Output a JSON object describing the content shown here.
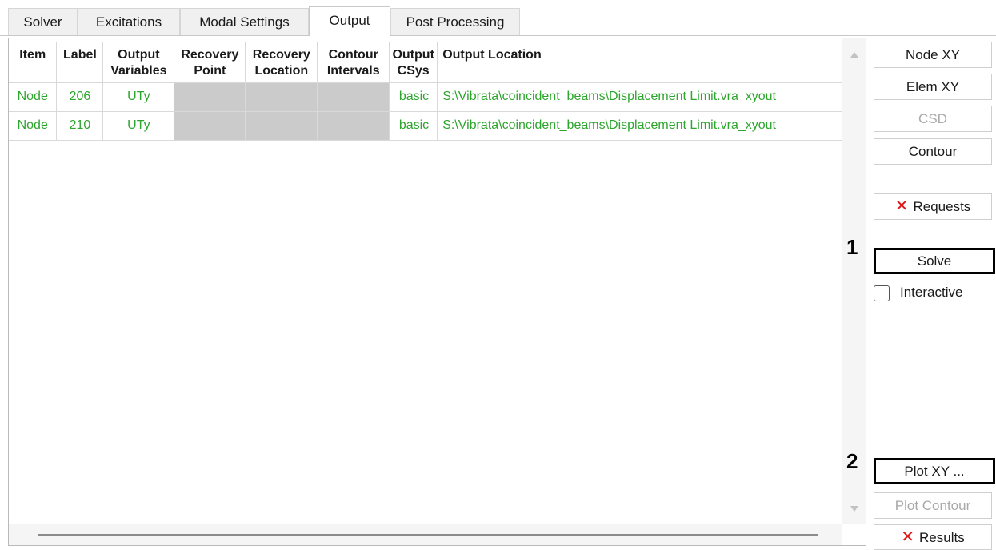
{
  "tabs": [
    {
      "label": "Solver"
    },
    {
      "label": "Excitations"
    },
    {
      "label": "Modal Settings"
    },
    {
      "label": "Output"
    },
    {
      "label": "Post Processing"
    }
  ],
  "active_tab": "Output",
  "table": {
    "headers": {
      "item": "Item",
      "label": "Label",
      "output_variables": [
        "Output",
        "Variables"
      ],
      "recovery_point": [
        "Recovery",
        "Point"
      ],
      "recovery_location": [
        "Recovery",
        "Location"
      ],
      "contour_intervals": [
        "Contour",
        "Intervals"
      ],
      "output_csys": [
        "Output",
        "CSys"
      ],
      "output_location": "Output Location"
    },
    "rows": [
      {
        "item": "Node",
        "label": "206",
        "output_variables": "UTy",
        "recovery_point": "",
        "recovery_location": "",
        "contour_intervals": "",
        "output_csys": "basic",
        "output_location": "S:\\Vibrata\\coincident_beams\\Displacement Limit.vra_xyout"
      },
      {
        "item": "Node",
        "label": "210",
        "output_variables": "UTy",
        "recovery_point": "",
        "recovery_location": "",
        "contour_intervals": "",
        "output_csys": "basic",
        "output_location": "S:\\Vibrata\\coincident_beams\\Displacement Limit.vra_xyout"
      }
    ],
    "row_text_color": "#2ea52e",
    "empty_cell_color": "#cbcbcb"
  },
  "buttons": {
    "node_xy": "Node XY",
    "elem_xy": "Elem XY",
    "csd": "CSD",
    "contour": "Contour",
    "requests": "Requests",
    "solve": "Solve",
    "plot_xy": "Plot XY ...",
    "plot_contour": "Plot Contour",
    "results": "Results"
  },
  "interactive": {
    "label": "Interactive",
    "checked": false
  },
  "callouts": {
    "one": "1",
    "two": "2"
  },
  "icons": {
    "delete": "x-mark-icon",
    "delete_color": "#e01818"
  }
}
